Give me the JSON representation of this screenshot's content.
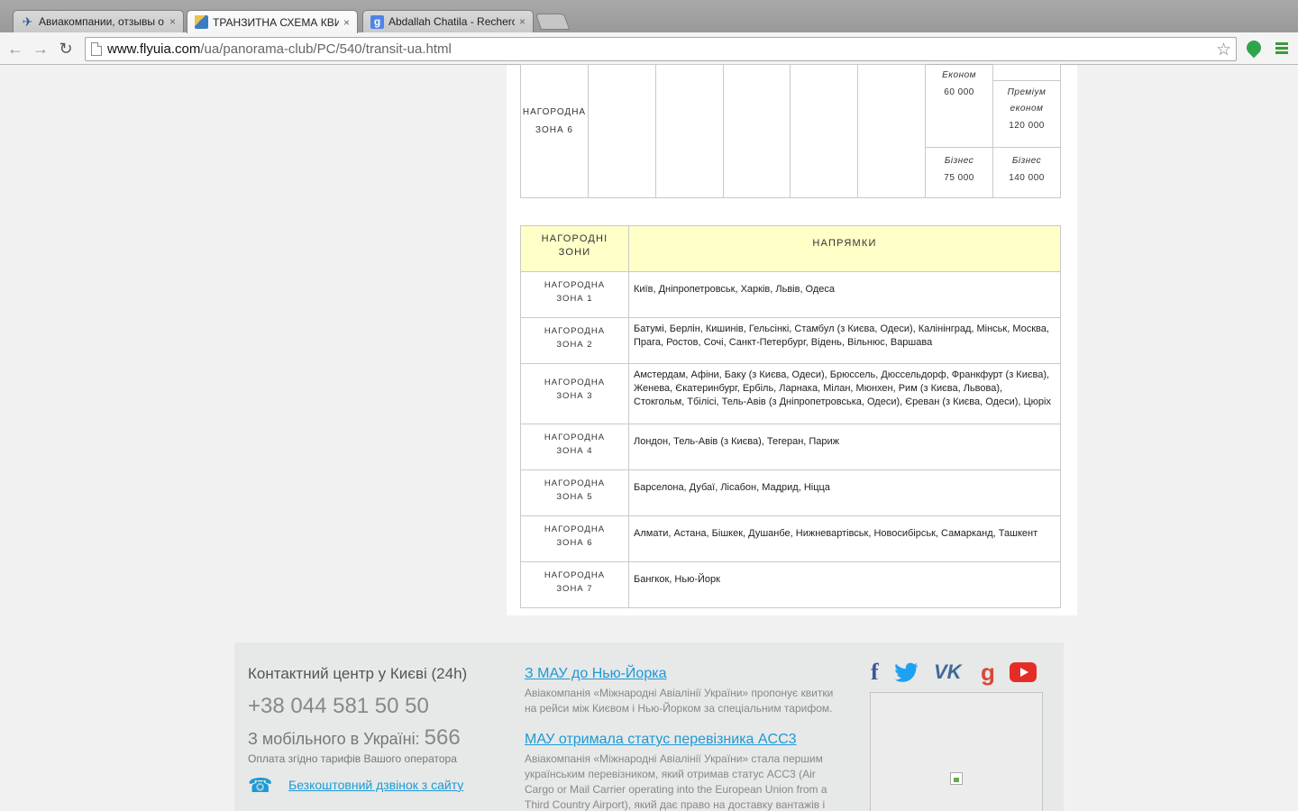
{
  "browser": {
    "tabs": [
      {
        "title": "Авиакомпании, отзывы о",
        "icon": "airplane-icon",
        "active": false
      },
      {
        "title": "ТРАНЗИТНА СХЕМА КВИТКІ",
        "icon": "flyuia-icon",
        "active": true
      },
      {
        "title": "Abdallah Chatila - Recherche",
        "icon": "google-icon",
        "active": false
      }
    ],
    "close_glyph": "×",
    "url_host": "www.flyuia.com",
    "url_path": "/ua/panorama-club/PC/540/transit-ua.html"
  },
  "zone6_row": {
    "label_line1": "НАГОРОДНА",
    "label_line2": "ЗОНА 6",
    "econom_label": "Економ",
    "econom_value": "60 000",
    "premium_label": "Преміум економ",
    "premium_value": "120 000",
    "business_label": "Бізнес",
    "business_value1": "75 000",
    "business_value2": "140 000"
  },
  "zones_table": {
    "header_zone": "НАГОРОДНІ ЗОНИ",
    "header_dirs": "НАПРЯМКИ",
    "rows": [
      {
        "zone1": "НАГОРОДНА",
        "zone2": "ЗОНА 1",
        "dirs": "Київ, Дніпропетровськ, Харків, Львів, Одеса"
      },
      {
        "zone1": "НАГОРОДНА",
        "zone2": "ЗОНА 2",
        "dirs": "Батумі, Берлін, Кишинів, Гельсінкі, Стамбул (з Києва, Одеси), Калінінград, Мінськ, Москва, Прага, Ростов, Сочі, Санкт-Петербург, Відень, Вільнюс, Варшава"
      },
      {
        "zone1": "НАГОРОДНА",
        "zone2": "ЗОНА 3",
        "dirs": "Амстердам, Афіни, Баку (з Києва, Одеси), Брюссель, Дюссельдорф, Франкфурт (з Києва), Женева, Єкатеринбург, Ербіль, Ларнака, Мілан, Мюнхен, Рим (з Києва, Львова), Стокгольм, Тбілісі, Тель-Авів (з Дніпропетровська, Одеси), Єреван (з Києва, Одеси), Цюріх"
      },
      {
        "zone1": "НАГОРОДНА",
        "zone2": "ЗОНА 4",
        "dirs": "Лондон, Тель-Авів (з Києва), Тегеран, Париж"
      },
      {
        "zone1": "НАГОРОДНА",
        "zone2": "ЗОНА 5",
        "dirs": "Барселона, Дубаї, Лісабон, Мадрид, Ніцца"
      },
      {
        "zone1": "НАГОРОДНА",
        "zone2": "ЗОНА 6",
        "dirs": "Алмати, Астана, Бішкек, Душанбе, Нижневартівськ, Новосибірськ, Самарканд, Ташкент"
      },
      {
        "zone1": "НАГОРОДНА",
        "zone2": "ЗОНА 7",
        "dirs": "Бангкок, Нью-Йорк"
      }
    ]
  },
  "footer": {
    "contact_title": "Контактний центр у Києві (24h)",
    "phone": "+38 044 581 50 50",
    "mobile_label": "З мобільного в Україні:",
    "mobile_number": "566",
    "tariff_note": "Оплата згідно тарифів Вашого оператора",
    "callback_link": "Безкоштовний дзвінок з сайту",
    "news": [
      {
        "title": "З МАУ до Нью-Йорка",
        "text": "Авіакомпанія «Міжнародні Авіалінії України» пропонує квитки на рейси між Києвом і Нью-Йорком за спеціальним тарифом."
      },
      {
        "title": "МАУ отримала статус перевізника ACC3",
        "text": "Авіакомпанія «Міжнародні Авіалінії України» стала першим українським перевізником, який отримав статус ACC3 (Air Cargo or Mail Carrier operating into the European Union from a Third Country Airport), який дає право на доставку вантажів і"
      }
    ],
    "social": [
      "facebook-icon",
      "twitter-icon",
      "vk-icon",
      "google-plus-icon",
      "youtube-icon"
    ]
  }
}
